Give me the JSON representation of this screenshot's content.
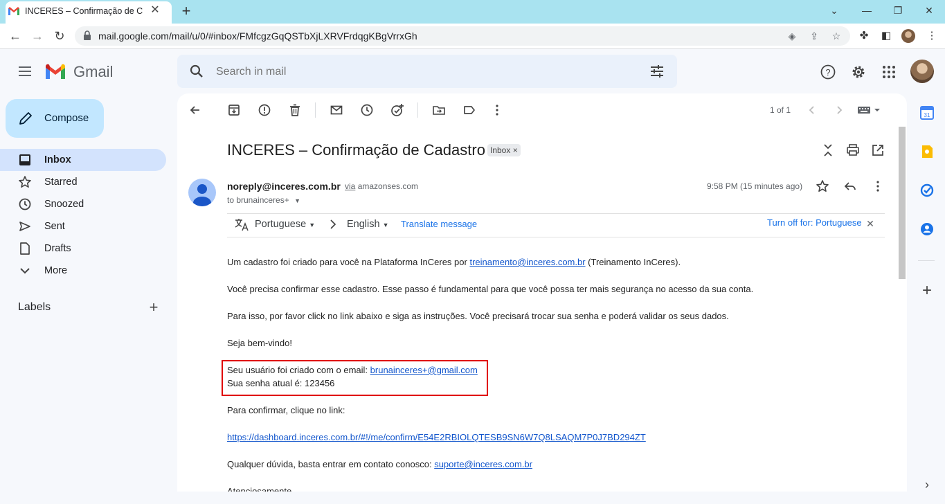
{
  "browser": {
    "tab_title": "INCERES – Confirmação de Cadastro",
    "url": "mail.google.com/mail/u/0/#inbox/FMfcgzGqQSTbXjLXRVFrdqgKBgVrrxGh"
  },
  "app": {
    "name": "Gmail"
  },
  "search": {
    "placeholder": "Search in mail"
  },
  "compose": {
    "label": "Compose"
  },
  "sidebar": {
    "items": [
      {
        "label": "Inbox",
        "icon": "inbox-icon",
        "active": true
      },
      {
        "label": "Starred",
        "icon": "star-icon"
      },
      {
        "label": "Snoozed",
        "icon": "clock-icon"
      },
      {
        "label": "Sent",
        "icon": "send-icon"
      },
      {
        "label": "Drafts",
        "icon": "draft-icon"
      },
      {
        "label": "More",
        "icon": "chevron-down-icon"
      }
    ],
    "labels_heading": "Labels"
  },
  "toolbar": {
    "pager": "1 of 1"
  },
  "message": {
    "subject": "INCERES – Confirmação de Cadastro",
    "badge": "Inbox",
    "sender": "noreply@inceres.com.br",
    "via": "via",
    "via_domain": "amazonses.com",
    "to": "to brunainceres+",
    "time": "9:58 PM (15 minutes ago)",
    "translate": {
      "from_lang": "Portuguese",
      "to_lang": "English",
      "translate_label": "Translate message",
      "turn_off_label": "Turn off for: Portuguese"
    },
    "body": {
      "p1_before": "Um cadastro foi criado para você na Plataforma InCeres por ",
      "p1_link": "treinamento@inceres.com.br",
      "p1_after": " (Treinamento InCeres).",
      "p2": "Você precisa confirmar esse cadastro. Esse passo é fundamental para que você possa ter mais segurança no acesso da sua conta.",
      "p3": "Para isso, por favor click no link abaixo e siga as instruções. Você precisará trocar sua senha e poderá validar os seus dados.",
      "p4": "Seja bem-vindo!",
      "user_line_before": "Seu usuário foi criado com o email: ",
      "user_email": "brunainceres+@gmail.com",
      "password_line": "Sua senha atual é: 123456",
      "confirm_intro": "Para confirmar, clique no link:",
      "confirm_link": "https://dashboard.inceres.com.br/#!/me/confirm/E54E2RBIOLQTESB9SN6W7Q8LSAQM7P0J7BD294ZT",
      "questions_before": "Qualquer dúvida, basta entrar em contato conosco: ",
      "support_email": "suporte@inceres.com.br",
      "closing": "Atenciosamente"
    }
  },
  "colors": {
    "highlight_border": "#e00000",
    "compose_bg": "#c2e7ff",
    "active_nav_bg": "#d3e3fd",
    "link": "#1155cc"
  }
}
